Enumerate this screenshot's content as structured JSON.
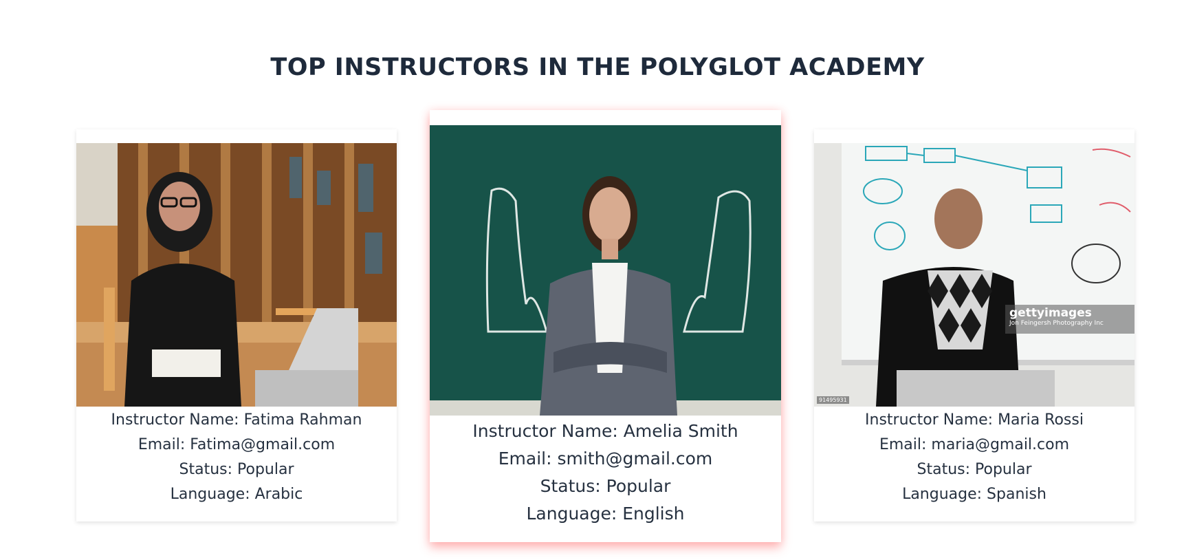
{
  "section": {
    "title": "TOP INSTRUCTORS IN THE POLYGLOT ACADEMY"
  },
  "instructors": [
    {
      "name_line": "Instructor Name: Fatima Rahman",
      "email_line": "Email: Fatima@gmail.com",
      "status_line": "Status: Popular",
      "language_line": "Language: Arabic",
      "photo_icon": "instructor-photo-library"
    },
    {
      "name_line": "Instructor Name: Amelia Smith",
      "email_line": "Email: smith@gmail.com",
      "status_line": "Status: Popular",
      "language_line": "Language: English",
      "photo_icon": "instructor-photo-chalkboard"
    },
    {
      "name_line": "Instructor Name: Maria Rossi",
      "email_line": "Email: maria@gmail.com",
      "status_line": "Status: Popular",
      "language_line": "Language: Spanish",
      "photo_icon": "instructor-photo-whiteboard",
      "watermark_brand": "gettyimages",
      "watermark_credit": "Jon Feingersh Photography Inc",
      "stock_id": "91495931"
    }
  ],
  "colors": {
    "title": "#1e2a3b",
    "text": "#263140",
    "featured_glow": "#ff3c3c"
  }
}
